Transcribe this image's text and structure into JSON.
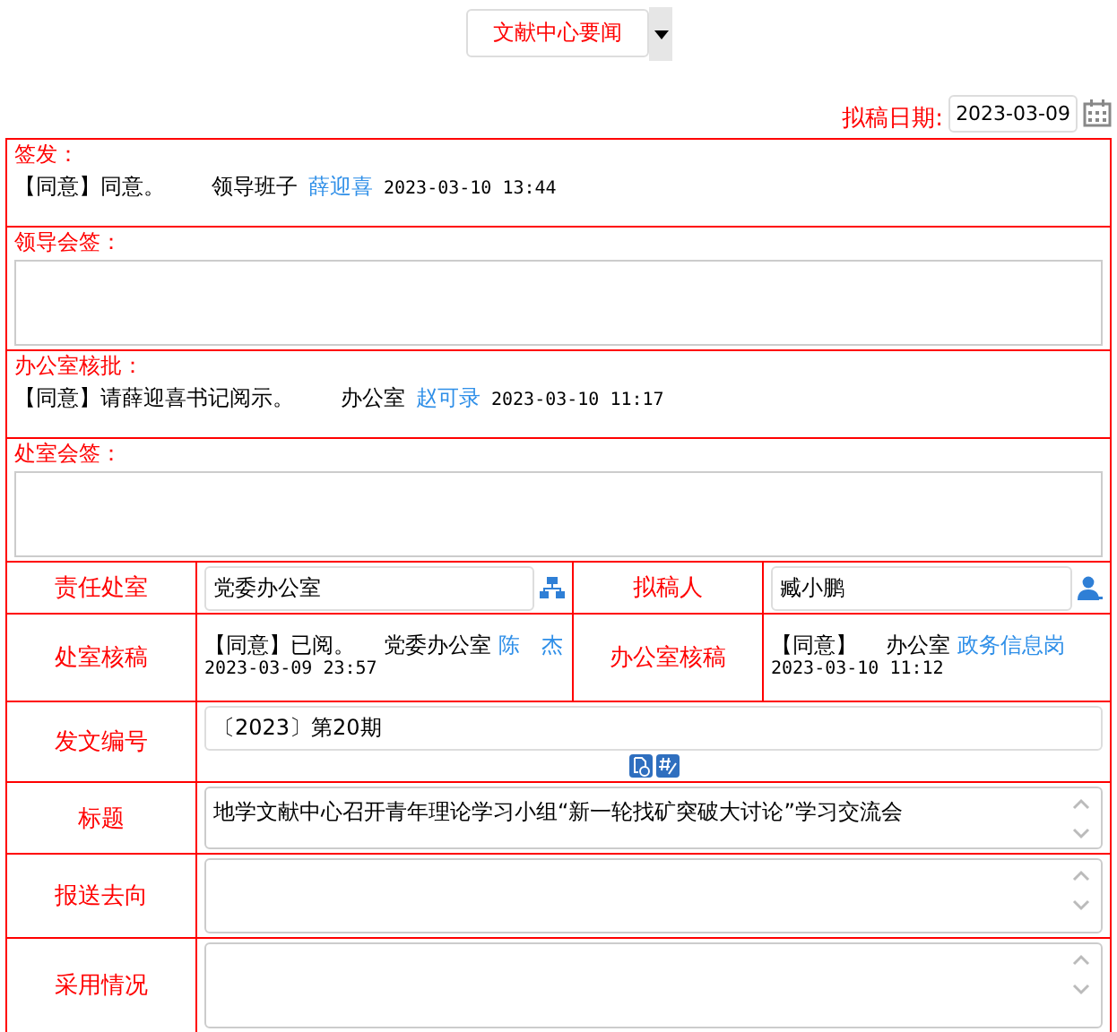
{
  "header_dropdown": {
    "value": "文献中心要闻"
  },
  "draft_date": {
    "label": "拟稿日期:",
    "value": "2023-03-09"
  },
  "sections": [
    {
      "label": "签发：",
      "kind": "opinion",
      "opinion": {
        "verdict": "【同意】",
        "comment": "同意。",
        "unit": "领导班子",
        "person": "薛迎喜",
        "time": "2023-03-10 13:44"
      }
    },
    {
      "label": "领导会签：",
      "kind": "input"
    },
    {
      "label": "办公室核批：",
      "kind": "opinion",
      "opinion": {
        "verdict": "【同意】",
        "comment": "请薛迎喜书记阅示。",
        "unit": "办公室",
        "person": "赵可录",
        "time": "2023-03-10 11:17"
      }
    },
    {
      "label": "处室会签：",
      "kind": "input"
    }
  ],
  "rows": [
    {
      "cells": [
        {
          "label": "责任处室",
          "kind": "picker",
          "value": "党委办公室"
        },
        {
          "label": "拟稿人",
          "kind": "picker",
          "value": "臧小鹏"
        }
      ]
    },
    {
      "cells": [
        {
          "label": "处室核稿",
          "kind": "opinion",
          "opinion": {
            "verdict": "【同意】",
            "comment": "已阅。",
            "unit": "党委办公室",
            "person": "陈　杰",
            "time": "2023-03-09 23:57"
          }
        },
        {
          "label": "办公室核稿",
          "kind": "opinion",
          "opinion": {
            "verdict": "【同意】",
            "unit": "办公室",
            "person": "政务信息岗",
            "time": "2023-03-10 11:12"
          }
        }
      ]
    },
    {
      "cells": [
        {
          "label": "发文编号",
          "kind": "number",
          "value": "〔2023〕第20期"
        }
      ]
    },
    {
      "cells": [
        {
          "label": "标题",
          "kind": "textarea",
          "value": "地学文献中心召开青年理论学习小组“新一轮找矿突破大讨论”学习交流会"
        }
      ]
    },
    {
      "cells": [
        {
          "label": "报送去向",
          "kind": "textarea"
        }
      ]
    },
    {
      "cells": [
        {
          "label": "采用情况",
          "kind": "textarea"
        }
      ]
    }
  ]
}
